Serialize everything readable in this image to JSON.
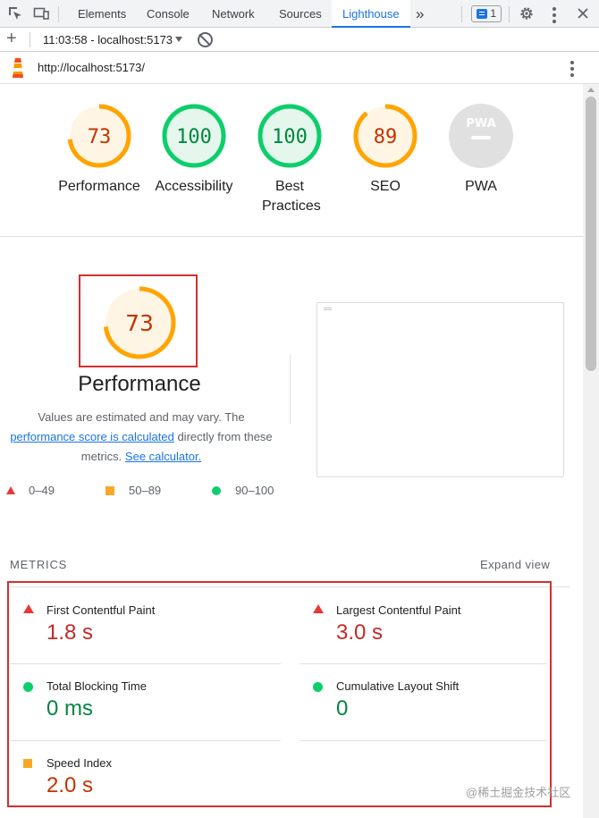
{
  "devtools": {
    "tabs": [
      "Elements",
      "Console",
      "Network",
      "Sources",
      "Lighthouse"
    ],
    "more_tabs": "»",
    "active_tab": "Lighthouse",
    "issues_count": "1"
  },
  "toolbar": {
    "report_selector": "11:03:58 - localhost:5173"
  },
  "report": {
    "url": "http://localhost:5173/"
  },
  "summary": [
    {
      "label": "Performance",
      "score": "73",
      "rating": "average"
    },
    {
      "label": "Accessibility",
      "score": "100",
      "rating": "pass"
    },
    {
      "label": "Best Practices",
      "score": "100",
      "rating": "pass"
    },
    {
      "label": "SEO",
      "score": "89",
      "rating": "average"
    },
    {
      "label": "PWA",
      "score": "PWA",
      "rating": "na"
    }
  ],
  "performance": {
    "score": "73",
    "title": "Performance",
    "desc_before": "Values are estimated and may vary. The ",
    "desc_link": "performance score is calculated",
    "desc_middle": " directly from these metrics. ",
    "desc_link2": "See calculator.",
    "legend": [
      {
        "range": "0–49",
        "shape": "triangle",
        "color": "#e53935"
      },
      {
        "range": "50–89",
        "shape": "square",
        "color": "#f9a825"
      },
      {
        "range": "90–100",
        "shape": "circle",
        "color": "#0cce6b"
      }
    ]
  },
  "metrics": {
    "header": "METRICS",
    "expand": "Expand view",
    "items": [
      {
        "name": "First Contentful Paint",
        "value": "1.8 s",
        "rating": "fail"
      },
      {
        "name": "Largest Contentful Paint",
        "value": "3.0 s",
        "rating": "fail"
      },
      {
        "name": "Total Blocking Time",
        "value": "0 ms",
        "rating": "pass"
      },
      {
        "name": "Cumulative Layout Shift",
        "value": "0",
        "rating": "pass"
      },
      {
        "name": "Speed Index",
        "value": "2.0 s",
        "rating": "average"
      }
    ]
  },
  "watermark": "@稀土掘金技术社区",
  "colors": {
    "accent": "#1a73e8",
    "pass": "#0cce6b",
    "average": "#ffa400",
    "fail": "#e53935"
  }
}
